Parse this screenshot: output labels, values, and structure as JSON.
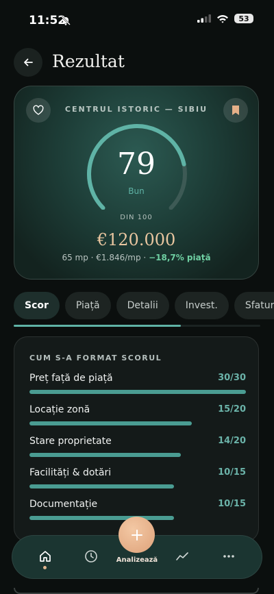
{
  "status_bar": {
    "time": "11:52",
    "battery": "53"
  },
  "header": {
    "title": "Rezultat"
  },
  "property": {
    "location": "CENTRUL ISTORIC — SIBIU",
    "score": "79",
    "score_value": 79,
    "score_max": 100,
    "grade": "Bun",
    "out_of": "DIN 100",
    "price": "€120.000",
    "details": "65 mp · €1.846/mp · ",
    "market_diff": "−18,7% piață"
  },
  "tabs": [
    {
      "label": "Scor",
      "active": true
    },
    {
      "label": "Piață",
      "active": false
    },
    {
      "label": "Detalii",
      "active": false
    },
    {
      "label": "Invest.",
      "active": false
    },
    {
      "label": "Sfaturi",
      "active": false
    }
  ],
  "breakdown": {
    "title": "CUM S-A FORMAT SCORUL",
    "criteria": [
      {
        "label": "Preț față de piață",
        "score": "30/30",
        "value": 30,
        "max": 30
      },
      {
        "label": "Locație zonă",
        "score": "15/20",
        "value": 15,
        "max": 20
      },
      {
        "label": "Stare proprietate",
        "score": "14/20",
        "value": 14,
        "max": 20
      },
      {
        "label": "Facilități & dotări",
        "score": "10/15",
        "value": 10,
        "max": 15
      },
      {
        "label": "Documentație",
        "score": "10/15",
        "value": 10,
        "max": 15
      }
    ]
  },
  "nav": {
    "analyze_label": "Analizează"
  },
  "colors": {
    "accent": "#5fb3a6",
    "price": "#e9c6a0",
    "fab": "#e6b089"
  }
}
